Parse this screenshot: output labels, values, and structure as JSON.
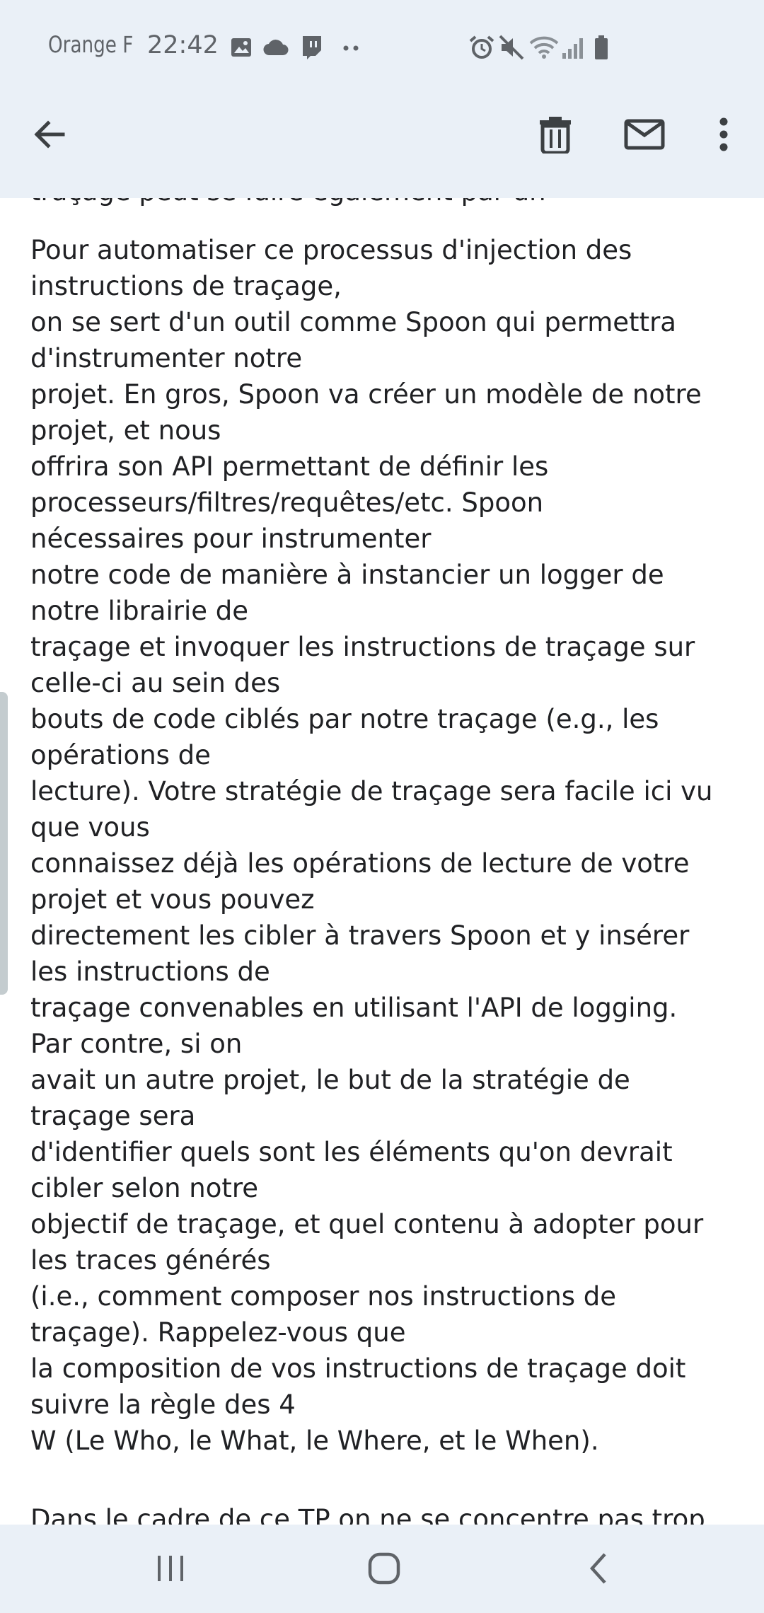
{
  "status_bar": {
    "carrier": "Orange F",
    "time": "22:42",
    "left_icons": [
      "image-icon",
      "cloud-icon",
      "twitch-icon",
      "more-dots-icon"
    ],
    "right_icons": [
      "alarm-icon",
      "mute-icon",
      "wifi-icon",
      "signal-icon",
      "battery-icon"
    ]
  },
  "toolbar": {
    "icons": [
      "back-arrow-icon",
      "delete-icon",
      "mark-unread-icon",
      "more-vert-icon"
    ]
  },
  "email": {
    "cut_top_line": "traçage peut se faire également par un",
    "lines": [
      "Pour automatiser ce processus d'injection des",
      "instructions de traçage,",
      "on se sert d'un outil comme Spoon qui permettra",
      "d'instrumenter notre",
      "projet. En gros, Spoon va créer un modèle de notre",
      "projet, et nous",
      "offrira son API permettant de définir les",
      "processeurs/filtres/requêtes/etc. Spoon",
      "nécessaires pour instrumenter",
      "notre code de manière à instancier un logger de",
      "notre librairie de",
      "traçage et invoquer les instructions de traçage sur",
      "celle-ci au sein des",
      "bouts de code ciblés par notre traçage (e.g., les",
      "opérations de",
      "lecture). Votre stratégie de traçage sera facile ici vu",
      "que vous",
      "connaissez déjà les opérations de lecture de votre",
      "projet et vous pouvez",
      "directement les cibler à travers Spoon et y insérer",
      "les instructions de",
      "traçage convenables en utilisant l'API de logging.",
      "Par contre, si on",
      "avait un autre projet, le but de la stratégie de",
      "traçage sera",
      "d'identifier quels sont les éléments qu'on devrait",
      "cibler selon notre",
      "objectif de traçage, et quel contenu à adopter pour",
      "les traces générés",
      "(i.e., comment composer nos instructions de",
      "traçage). Rappelez-vous que",
      "la composition de vos instructions de traçage doit",
      "suivre la règle des 4",
      "W (Le Who, le What, le Where, et le When)."
    ],
    "cut_bottom_line": "Dans le cadre de ce TP on ne se concentre pas trop"
  },
  "nav_bar": {
    "icons": [
      "recent-apps-icon",
      "home-icon",
      "back-icon"
    ]
  },
  "colors": {
    "bar_background": "#eaf0f7",
    "text": "#202124",
    "icon": "#3c4043",
    "status_icon": "#5f6368"
  }
}
